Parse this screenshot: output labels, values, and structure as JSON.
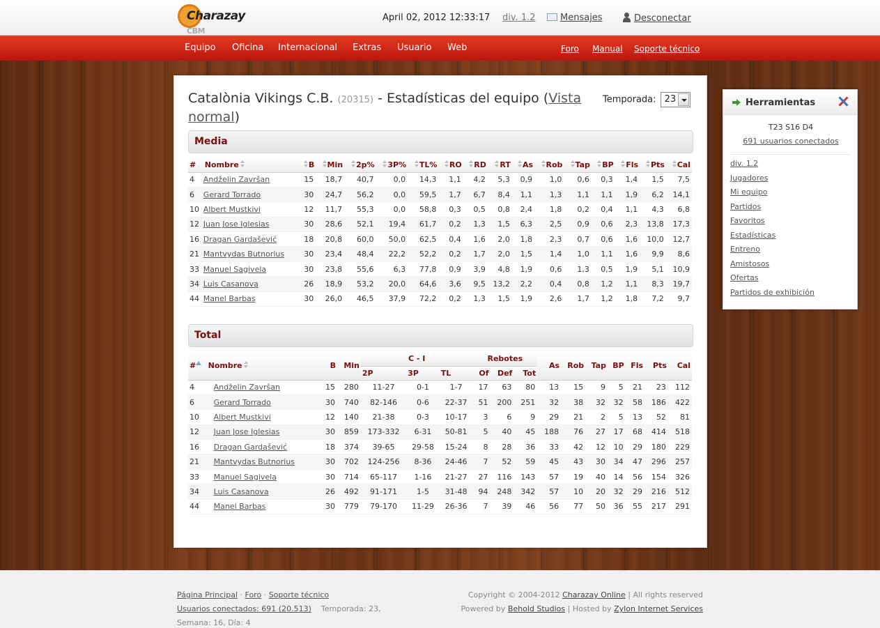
{
  "header": {
    "logo_text": "Charazay",
    "logo_sub": "CBM",
    "datetime": "April 02, 2012 12:33:17",
    "division": "div. 1.2",
    "messages": "Mensajes",
    "logout": "Desconectar"
  },
  "nav": {
    "items": [
      "Equipo",
      "Oficina",
      "Internacional",
      "Extras",
      "Usuario",
      "Web"
    ],
    "secondary": [
      "Foro",
      "Manual",
      "Soporte técnico"
    ]
  },
  "page": {
    "team_name": "Catalònia Vikings C.B.",
    "team_id": "(20315)",
    "title_rest": "- Estadísticas del equipo",
    "view_link": "Vista normal",
    "paren_open": "(",
    "paren_close": ")",
    "season_label": "Temporada:",
    "season_value": "23"
  },
  "media": {
    "heading": "Media",
    "columns": [
      "#",
      "Nombre",
      "B",
      "Min",
      "2p%",
      "3P%",
      "TL%",
      "RO",
      "RD",
      "RT",
      "As",
      "Rob",
      "Tap",
      "BP",
      "Fls",
      "Pts",
      "Cal"
    ],
    "rows": [
      [
        "4",
        "Andželin Završan",
        "15",
        "18,7",
        "40,7",
        "0,0",
        "14,3",
        "1,1",
        "4,2",
        "5,3",
        "0,9",
        "1,0",
        "0,6",
        "0,3",
        "1,4",
        "1,5",
        "7,5"
      ],
      [
        "6",
        "Gerard Torrado",
        "30",
        "24,7",
        "56,2",
        "0,0",
        "59,5",
        "1,7",
        "6,7",
        "8,4",
        "1,1",
        "1,3",
        "1,1",
        "1,1",
        "1,9",
        "6,2",
        "14,1"
      ],
      [
        "10",
        "Albert Mustkivi",
        "12",
        "11,7",
        "55,3",
        "0,0",
        "58,8",
        "0,3",
        "0,5",
        "0,8",
        "2,4",
        "1,8",
        "0,2",
        "0,4",
        "1,1",
        "4,3",
        "6,8"
      ],
      [
        "12",
        "Juan Jose Iglesias",
        "30",
        "28,6",
        "52,1",
        "19,4",
        "61,7",
        "0,2",
        "1,3",
        "1,5",
        "6,3",
        "2,5",
        "0,9",
        "0,6",
        "2,3",
        "13,8",
        "17,3"
      ],
      [
        "16",
        "Dragan Gardašević",
        "18",
        "20,8",
        "60,0",
        "50,0",
        "62,5",
        "0,4",
        "1,6",
        "2,0",
        "1,8",
        "2,3",
        "0,7",
        "0,6",
        "1,6",
        "10,0",
        "12,7"
      ],
      [
        "21",
        "Mantvydas Butnorius",
        "30",
        "23,4",
        "48,4",
        "22,2",
        "52,2",
        "0,2",
        "1,7",
        "2,0",
        "1,5",
        "1,4",
        "1,0",
        "1,1",
        "1,6",
        "9,9",
        "8,6"
      ],
      [
        "33",
        "Manuel Sagivela",
        "30",
        "23,8",
        "55,6",
        "6,3",
        "77,8",
        "0,9",
        "3,9",
        "4,8",
        "1,9",
        "0,6",
        "1,3",
        "0,5",
        "1,9",
        "5,1",
        "10,9"
      ],
      [
        "34",
        "Luis Casanova",
        "26",
        "18,9",
        "53,2",
        "20,0",
        "64,6",
        "3,6",
        "9,5",
        "13,2",
        "2,2",
        "0,4",
        "0,8",
        "1,2",
        "1,1",
        "8,3",
        "19,7"
      ],
      [
        "44",
        "Manel Barbas",
        "30",
        "26,0",
        "46,5",
        "37,9",
        "72,2",
        "0,2",
        "1,3",
        "1,5",
        "1,9",
        "2,6",
        "1,7",
        "1,2",
        "1,8",
        "7,2",
        "9,7"
      ]
    ]
  },
  "total": {
    "heading": "Total",
    "group_ci": "C - I",
    "group_reb": "Rebotes",
    "columns": [
      "#",
      "Nombre",
      "B",
      "Min",
      "2P",
      "3P",
      "TL",
      "Of",
      "Def",
      "Tot",
      "As",
      "Rob",
      "Tap",
      "BP",
      "Fls",
      "Pts",
      "Cal"
    ],
    "rows": [
      [
        "4",
        "Andželin Završan",
        "15",
        "280",
        "11-27",
        "0-1",
        "1-7",
        "17",
        "63",
        "80",
        "13",
        "15",
        "9",
        "5",
        "21",
        "23",
        "112"
      ],
      [
        "6",
        "Gerard Torrado",
        "30",
        "740",
        "82-146",
        "0-6",
        "22-37",
        "51",
        "200",
        "251",
        "32",
        "38",
        "32",
        "32",
        "58",
        "186",
        "422"
      ],
      [
        "10",
        "Albert Mustkivi",
        "12",
        "140",
        "21-38",
        "0-3",
        "10-17",
        "3",
        "6",
        "9",
        "29",
        "21",
        "2",
        "5",
        "13",
        "52",
        "81"
      ],
      [
        "12",
        "Juan Jose Iglesias",
        "30",
        "859",
        "173-332",
        "6-31",
        "50-81",
        "5",
        "40",
        "45",
        "188",
        "76",
        "27",
        "17",
        "68",
        "414",
        "518"
      ],
      [
        "16",
        "Dragan Gardašević",
        "18",
        "374",
        "39-65",
        "29-58",
        "15-24",
        "8",
        "28",
        "36",
        "33",
        "42",
        "12",
        "10",
        "29",
        "180",
        "229"
      ],
      [
        "21",
        "Mantvydas Butnorius",
        "30",
        "702",
        "124-256",
        "8-36",
        "24-46",
        "7",
        "52",
        "59",
        "45",
        "43",
        "30",
        "34",
        "47",
        "296",
        "257"
      ],
      [
        "33",
        "Manuel Sagivela",
        "30",
        "714",
        "65-117",
        "1-16",
        "21-27",
        "27",
        "116",
        "143",
        "57",
        "19",
        "40",
        "14",
        "56",
        "154",
        "326"
      ],
      [
        "34",
        "Luis Casanova",
        "26",
        "492",
        "91-171",
        "1-5",
        "31-48",
        "94",
        "248",
        "342",
        "57",
        "10",
        "20",
        "32",
        "29",
        "216",
        "512"
      ],
      [
        "44",
        "Manel Barbas",
        "30",
        "779",
        "79-170",
        "11-29",
        "26-36",
        "7",
        "39",
        "46",
        "56",
        "77",
        "50",
        "36",
        "55",
        "217",
        "291"
      ]
    ]
  },
  "sidebar": {
    "title": "Herramientas",
    "date": "T23 S16 D4",
    "users": "691 usuarios conectados",
    "links": [
      "div. 1.2",
      "Jugadores",
      "Mi equipo",
      "Partidos",
      "Favoritos",
      "Estadísticas",
      "Entreno",
      "Amistosos",
      "Ofertas",
      "Partidos de exhibición"
    ]
  },
  "footer": {
    "home": "Página Principal",
    "forum": "Foro",
    "support": "Soporte técnico",
    "sep": "·",
    "users": "Usuarios conectados: 691 (20.513)",
    "season_info": "Temporada: 23, Semana: 16, Día: 4",
    "copyright": "Copyright © 2004-2012",
    "company": "Charazay Online",
    "rights": "| All rights reserved",
    "powered": "Powered by",
    "behold": "Behold Studios",
    "hosted": "| Hosted by",
    "zylon": "Zylon Internet Services"
  }
}
